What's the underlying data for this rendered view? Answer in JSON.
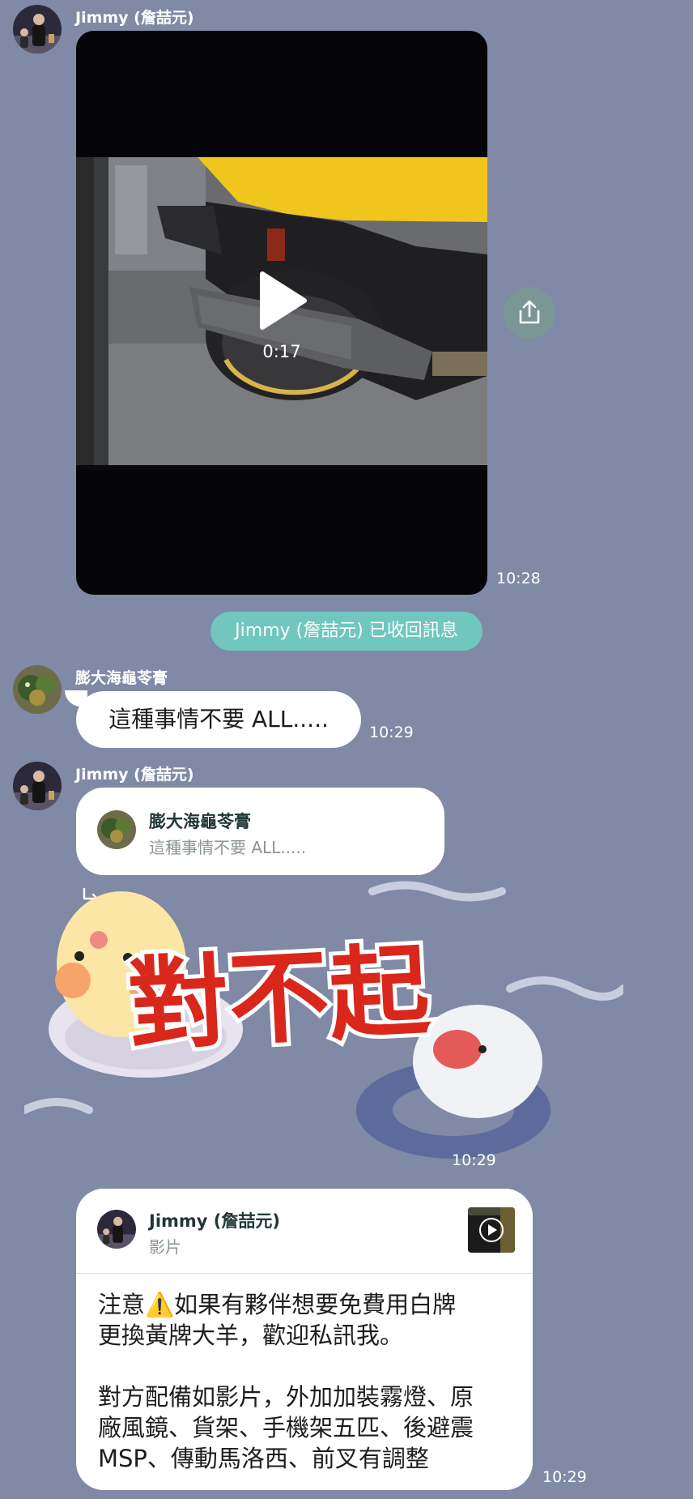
{
  "messages": {
    "first": {
      "sender": "Jimmy (詹喆元)",
      "video_duration": "0:17",
      "time": "10:28"
    },
    "system_notice": "Jimmy (詹喆元) 已收回訊息",
    "second": {
      "sender": "膨大海龜苓膏",
      "text": "這種事情不要 ALL.....",
      "time": "10:29"
    },
    "third": {
      "sender": "Jimmy (詹喆元)",
      "reply_to": {
        "sender": "膨大海龜苓膏",
        "text": "這種事情不要 ALL....."
      },
      "sticker_text": "對不起",
      "time": "10:29"
    },
    "fourth": {
      "author": "Jimmy (詹喆元)",
      "type_label": "影片",
      "paragraph1_line1": "注意⚠️如果有夥伴想要免費用白牌",
      "paragraph1_line2": "更換黃牌大羊，歡迎私訊我。",
      "paragraph2_line1": "對方配備如影片，外加加裝霧燈、原",
      "paragraph2_line2": "廠風鏡、貨架、手機架五匹、後避震",
      "paragraph2_line3": "MSP、傳動馬洛西、前叉有調整",
      "time": "10:29"
    }
  },
  "icons": {
    "play": "play-icon",
    "share": "share-icon",
    "reply_arrow": "reply-arrow-icon",
    "video_thumb_play": "play-circle-icon"
  },
  "colors": {
    "chat_background": "#8089a5",
    "system_pill": "#6fc7bd",
    "bubble": "#ffffff",
    "sticker_red": "#d9271c"
  }
}
